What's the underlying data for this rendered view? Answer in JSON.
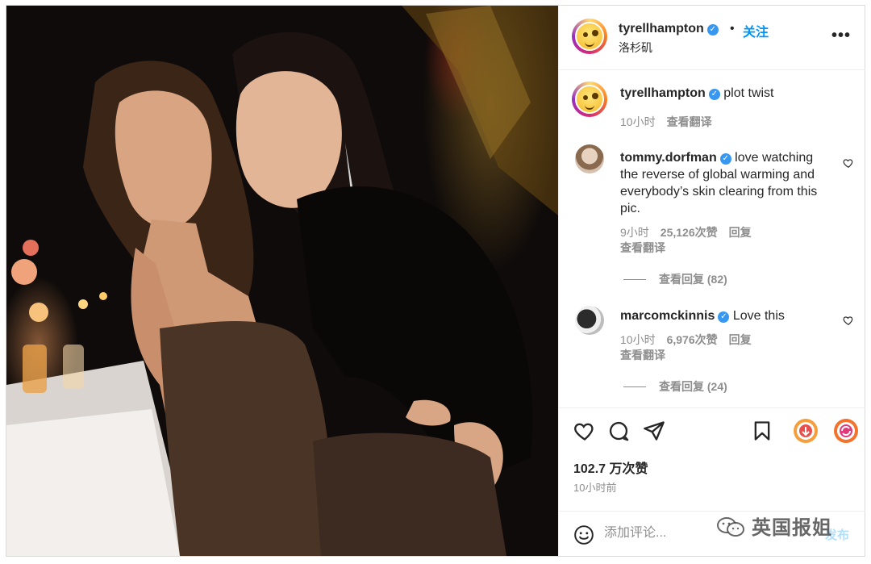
{
  "post": {
    "author": "tyrellhampton",
    "follow_label": "关注",
    "separator": "•",
    "location": "洛杉矶",
    "more_label": "•••"
  },
  "caption": {
    "username": "tyrellhampton",
    "text": "plot twist",
    "time": "10小时",
    "translate": "查看翻译"
  },
  "comments": [
    {
      "username": "tommy.dorfman",
      "text": "love watching the reverse of global warming and everybody’s skin clearing from this pic.",
      "time": "9小时",
      "likes": "25,126次赞",
      "reply": "回复",
      "translate": "查看翻译",
      "view_replies": "查看回复 (82)"
    },
    {
      "username": "marcomckinnis",
      "text": "Love this",
      "time": "10小时",
      "likes": "6,976次赞",
      "reply": "回复",
      "translate": "查看翻译",
      "view_replies": "查看回复 (24)"
    }
  ],
  "actions": {
    "likes_count": "102.7 万次赞",
    "posted_time": "10小时前"
  },
  "composer": {
    "placeholder": "添加评论...",
    "post_label": "发布"
  },
  "watermark": "英国报姐",
  "colors": {
    "accent_blue": "#0095f6",
    "verified_blue": "#3897f0",
    "muted_text": "#8e8e8e"
  },
  "icons": [
    "heart-icon",
    "comment-icon",
    "share-icon",
    "bookmark-icon",
    "emoji-icon",
    "verified-badge-icon",
    "more-options-icon"
  ]
}
